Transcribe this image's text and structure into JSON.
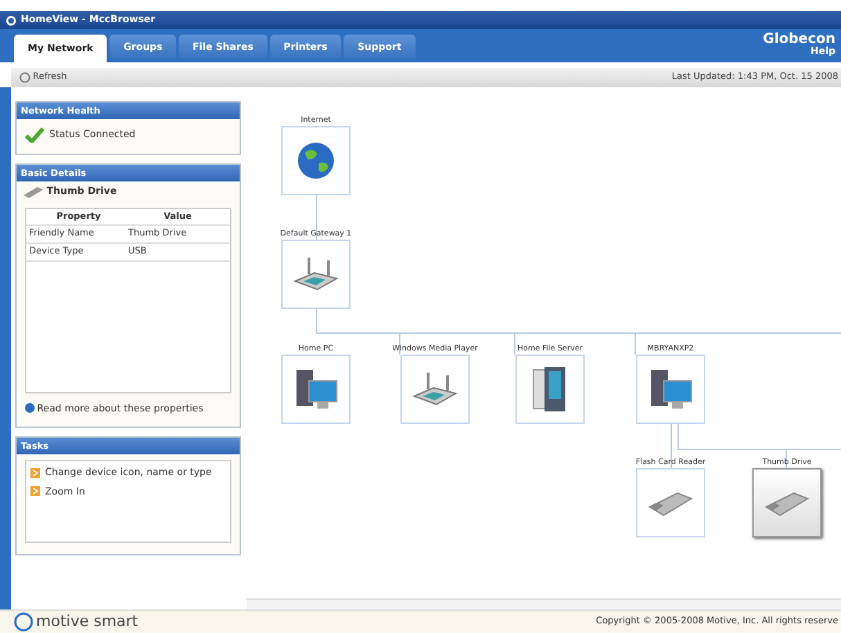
{
  "window": {
    "title": "HomeView - MccBrowser"
  },
  "tabs": [
    {
      "label": "My Network",
      "selected": true
    },
    {
      "label": "Groups",
      "selected": false
    },
    {
      "label": "File Shares",
      "selected": false
    },
    {
      "label": "Printers",
      "selected": false
    },
    {
      "label": "Support",
      "selected": false
    }
  ],
  "brand": {
    "name": "Globecon",
    "help": "Help"
  },
  "toolbar": {
    "refresh": "Refresh",
    "last_updated": "Last Updated: 1:43 PM, Oct. 15 2008"
  },
  "network_health": {
    "title": "Network Health",
    "status": "Status Connected"
  },
  "basic_details": {
    "title": "Basic Details",
    "device": "Thumb Drive",
    "columns": [
      "Property",
      "Value"
    ],
    "rows": [
      [
        "Friendly Name",
        "Thumb Drive"
      ],
      [
        "Device Type",
        "USB"
      ]
    ],
    "link": "Read more about these properties"
  },
  "tasks": {
    "title": "Tasks",
    "items": [
      "Change device icon, name or type",
      "Zoom In"
    ]
  },
  "network_map": {
    "nodes": [
      {
        "label": "Internet",
        "kind": "globe",
        "selected": false
      },
      {
        "label": "Default Gateway 1",
        "kind": "router",
        "selected": false
      },
      {
        "label": "Home PC",
        "kind": "computer",
        "selected": false
      },
      {
        "label": "Windows Media Player",
        "kind": "router",
        "selected": false
      },
      {
        "label": "Home File Server",
        "kind": "server",
        "selected": false
      },
      {
        "label": "MBRYANXP2",
        "kind": "computer",
        "selected": false
      },
      {
        "label": "Flash Card Reader",
        "kind": "usb",
        "selected": false
      },
      {
        "label": "Thumb Drive",
        "kind": "usb",
        "selected": true
      }
    ]
  },
  "footer": {
    "logo": "motive smart",
    "copyright": "Copyright © 2005-2008 Motive, Inc. All rights reserve"
  }
}
